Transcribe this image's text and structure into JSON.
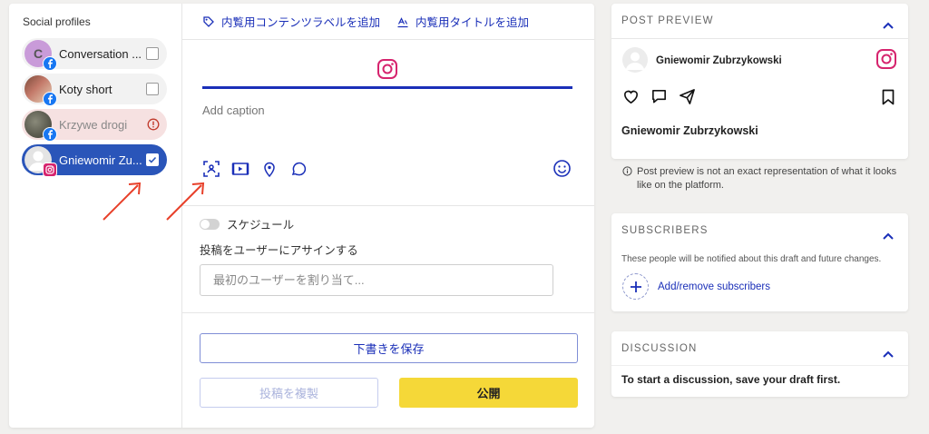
{
  "profiles_panel": {
    "title": "Social profiles",
    "items": [
      {
        "name": "Conversation ...",
        "initial": "C",
        "network": "facebook",
        "state": "unchecked"
      },
      {
        "name": "Koty short",
        "network": "facebook",
        "state": "unchecked"
      },
      {
        "name": "Krzywe drogi",
        "network": "facebook",
        "state": "error"
      },
      {
        "name": "Gniewomir Zu...",
        "network": "instagram",
        "state": "selected"
      }
    ]
  },
  "editor": {
    "top_links": [
      {
        "label": "内覧用コンテンツラベルを追加",
        "icon": "tag-icon"
      },
      {
        "label": "内覧用タイトルを追加",
        "icon": "title-icon"
      }
    ],
    "active_network_tab": "instagram",
    "caption_placeholder": "Add caption",
    "tools": [
      "media-picker-icon",
      "video-icon",
      "location-icon",
      "comment-icon"
    ],
    "schedule_label": "スケジュール",
    "assign_label": "投稿をユーザーにアサインする",
    "assign_placeholder": "最初のユーザーを割り当て...",
    "save_draft_label": "下書きを保存",
    "duplicate_label": "投稿を複製",
    "publish_label": "公開"
  },
  "post_preview": {
    "header": "POST PREVIEW",
    "account_name": "Gniewomir Zubrzykowski",
    "caption_author": "Gniewomir Zubrzykowski",
    "note": "Post preview is not an exact representation of what it looks like on the platform."
  },
  "subscribers": {
    "header": "SUBSCRIBERS",
    "description": "These people will be notified about this draft and future changes.",
    "add_label": "Add/remove subscribers"
  },
  "discussion": {
    "header": "DISCUSSION",
    "text": "To start a discussion, save your draft first."
  },
  "colors": {
    "accent": "#1a2fb8",
    "selected_profile": "#2a55b9",
    "publish": "#f5d838",
    "instagram": "#d6246e",
    "facebook": "#1877f2",
    "annotation_arrow": "#e8402a"
  }
}
